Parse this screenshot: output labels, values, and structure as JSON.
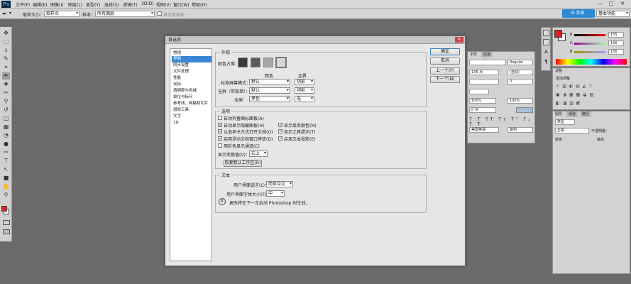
{
  "app": {
    "logo": "Ps"
  },
  "menubar": {
    "items": [
      "文件(F)",
      "编辑(E)",
      "图像(I)",
      "图层(L)",
      "类型(Y)",
      "选择(S)",
      "滤镜(T)",
      "3D(D)",
      "视图(V)",
      "窗口(W)",
      "帮助(H)"
    ],
    "win_min": "—",
    "win_max": "□",
    "win_close": "✕"
  },
  "optionsbar": {
    "sample_size_label": "取样大小：",
    "sample_size_value": "取样点",
    "sample_label": "样本：",
    "sample_value": "所有图层",
    "show_ring_label": "显示取样环",
    "share_label": "IS 共享",
    "workspace_value": "基本功能"
  },
  "toolbar": {
    "tools": [
      "move-tool",
      "marquee-tool",
      "lasso-tool",
      "quick-select-tool",
      "crop-tool",
      "eyedropper-tool",
      "healing-tool",
      "brush-tool",
      "clone-stamp-tool",
      "history-brush-tool",
      "eraser-tool",
      "gradient-tool",
      "blur-tool",
      "dodge-tool",
      "pen-tool",
      "type-tool",
      "path-select-tool",
      "shape-tool",
      "hand-tool",
      "zoom-tool"
    ],
    "glyphs": [
      "✥",
      "⬚",
      "ↄ",
      "✎",
      "⌗",
      "✒",
      "✚",
      "✏",
      "⚲",
      "↺",
      "◫",
      "▦",
      "◔",
      "●",
      "✑",
      "T",
      "↖",
      "■",
      "✋",
      "⚲"
    ]
  },
  "dialog": {
    "title": "首选项",
    "close": "✕",
    "nav": [
      "常规",
      "界面",
      "同步设置",
      "文件处理",
      "性能",
      "光标",
      "透明度与色域",
      "单位与标尺",
      "参考线、网格和切片",
      "增效工具",
      "文字",
      "3D"
    ],
    "selected_nav_index": 1,
    "appearance": {
      "legend": "外观",
      "color_scheme_label": "颜色方案：",
      "scheme_colors": [
        "#3a3a3a",
        "#5a5a5a",
        "#a6a6a6",
        "#d8d8d8"
      ],
      "col_color": "颜色",
      "col_border": "边界",
      "rows": [
        {
          "label": "标准屏幕模式：",
          "color": "默认",
          "border": "阴影"
        },
        {
          "label": "全屏（带菜单）：",
          "color": "默认",
          "border": "阴影"
        },
        {
          "label": "全屏：",
          "color": "黑色",
          "border": "无"
        }
      ]
    },
    "options": {
      "legend": "选项",
      "left": [
        {
          "label": "自动折叠图标面板(A)",
          "checked": false
        },
        {
          "label": "自动显示隐藏面板(H)",
          "checked": true
        },
        {
          "label": "以选项卡方式打开文档(O)",
          "checked": true
        },
        {
          "label": "启用浮动文档窗口停放(D)",
          "checked": true
        },
        {
          "label": "用彩色显示通道(C)",
          "checked": false
        }
      ],
      "right": [
        {
          "label": "显示菜单颜色(M)",
          "checked": true
        },
        {
          "label": "显示工具提示(T)",
          "checked": true
        },
        {
          "label": "启用文本投影(E)",
          "checked": true
        }
      ],
      "transform_label": "显示变换值(V)：",
      "transform_value": "右上",
      "restore_button": "恢复默认工作区(R)"
    },
    "text": {
      "legend": "文本",
      "lang_label": "用户界面语言(L)：",
      "lang_value": "简体中文",
      "font_size_label": "用户界面字体大小(F)：",
      "font_size_value": "中",
      "notice": "更改将在下一次启动 Photoshop 时生效。",
      "info_icon": "i"
    },
    "buttons": {
      "ok": "确定",
      "cancel": "取消",
      "prev": "上一个(P)",
      "next": "下一个(N)"
    }
  },
  "color_panel": {
    "slider_values": [
      "155",
      "156",
      "156"
    ],
    "slider_labels": [
      "R",
      "G",
      "B"
    ]
  },
  "char_panel": {
    "tabs": [
      "字符",
      "段落"
    ],
    "size_value": "135 点",
    "leading_value": "(自动)",
    "tracking_value": "0",
    "scale_v": "100%",
    "scale_h": "100%",
    "baseline": "0 点",
    "lang_value": "美国英语",
    "aa_value": "锐利",
    "font_style_value": "Regular"
  },
  "adjust_panel": {
    "tab": "调整",
    "add_label": "添加调整"
  },
  "layers_panel": {
    "tabs": [
      "图层",
      "通道",
      "路径"
    ],
    "kind_value": "类型",
    "blend_value": "正常",
    "opacity_label": "不透明度：",
    "lock_label": "锁定：",
    "fill_label": "填充："
  },
  "colors": {
    "accent": "#3a86d6",
    "share_blue": "#2d8ad4",
    "foreground": "#e02020",
    "background_swatch": "#ffffff"
  }
}
